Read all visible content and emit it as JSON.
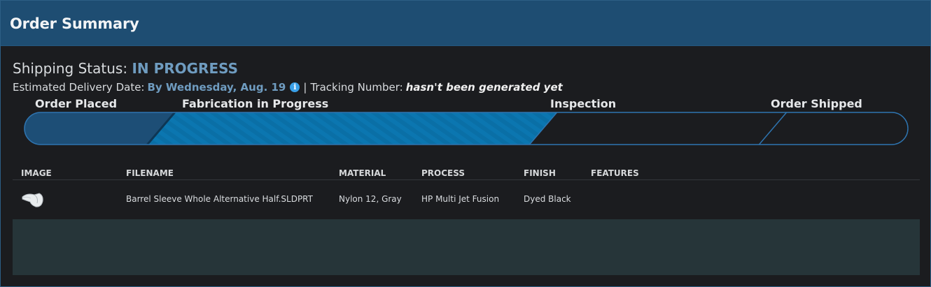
{
  "header": {
    "title": "Order Summary"
  },
  "status": {
    "label": "Shipping Status:",
    "value": "IN PROGRESS",
    "delivery_label": "Estimated Delivery Date:",
    "delivery_value": "By Wednesday, Aug. 19",
    "info_icon": "info-icon",
    "separator": "|",
    "tracking_label": "Tracking Number:",
    "tracking_value": "hasn't been generated yet"
  },
  "progress": {
    "steps": [
      "Order Placed",
      "Fabrication in Progress",
      "Inspection",
      "Order Shipped"
    ],
    "current_step": 2,
    "colors": {
      "done": "#1d4e76",
      "active": "#0a6fa6",
      "pending": "#1b1c1f",
      "border": "#2e74b0"
    }
  },
  "table": {
    "columns": [
      "IMAGE",
      "FILENAME",
      "MATERIAL",
      "PROCESS",
      "FINISH",
      "FEATURES"
    ],
    "rows": [
      {
        "image": "part-thumbnail",
        "filename": "Barrel Sleeve Whole Alternative Half.SLDPRT",
        "material": "Nylon 12, Gray",
        "process": "HP Multi Jet Fusion",
        "finish": "Dyed Black",
        "features": ""
      }
    ]
  }
}
